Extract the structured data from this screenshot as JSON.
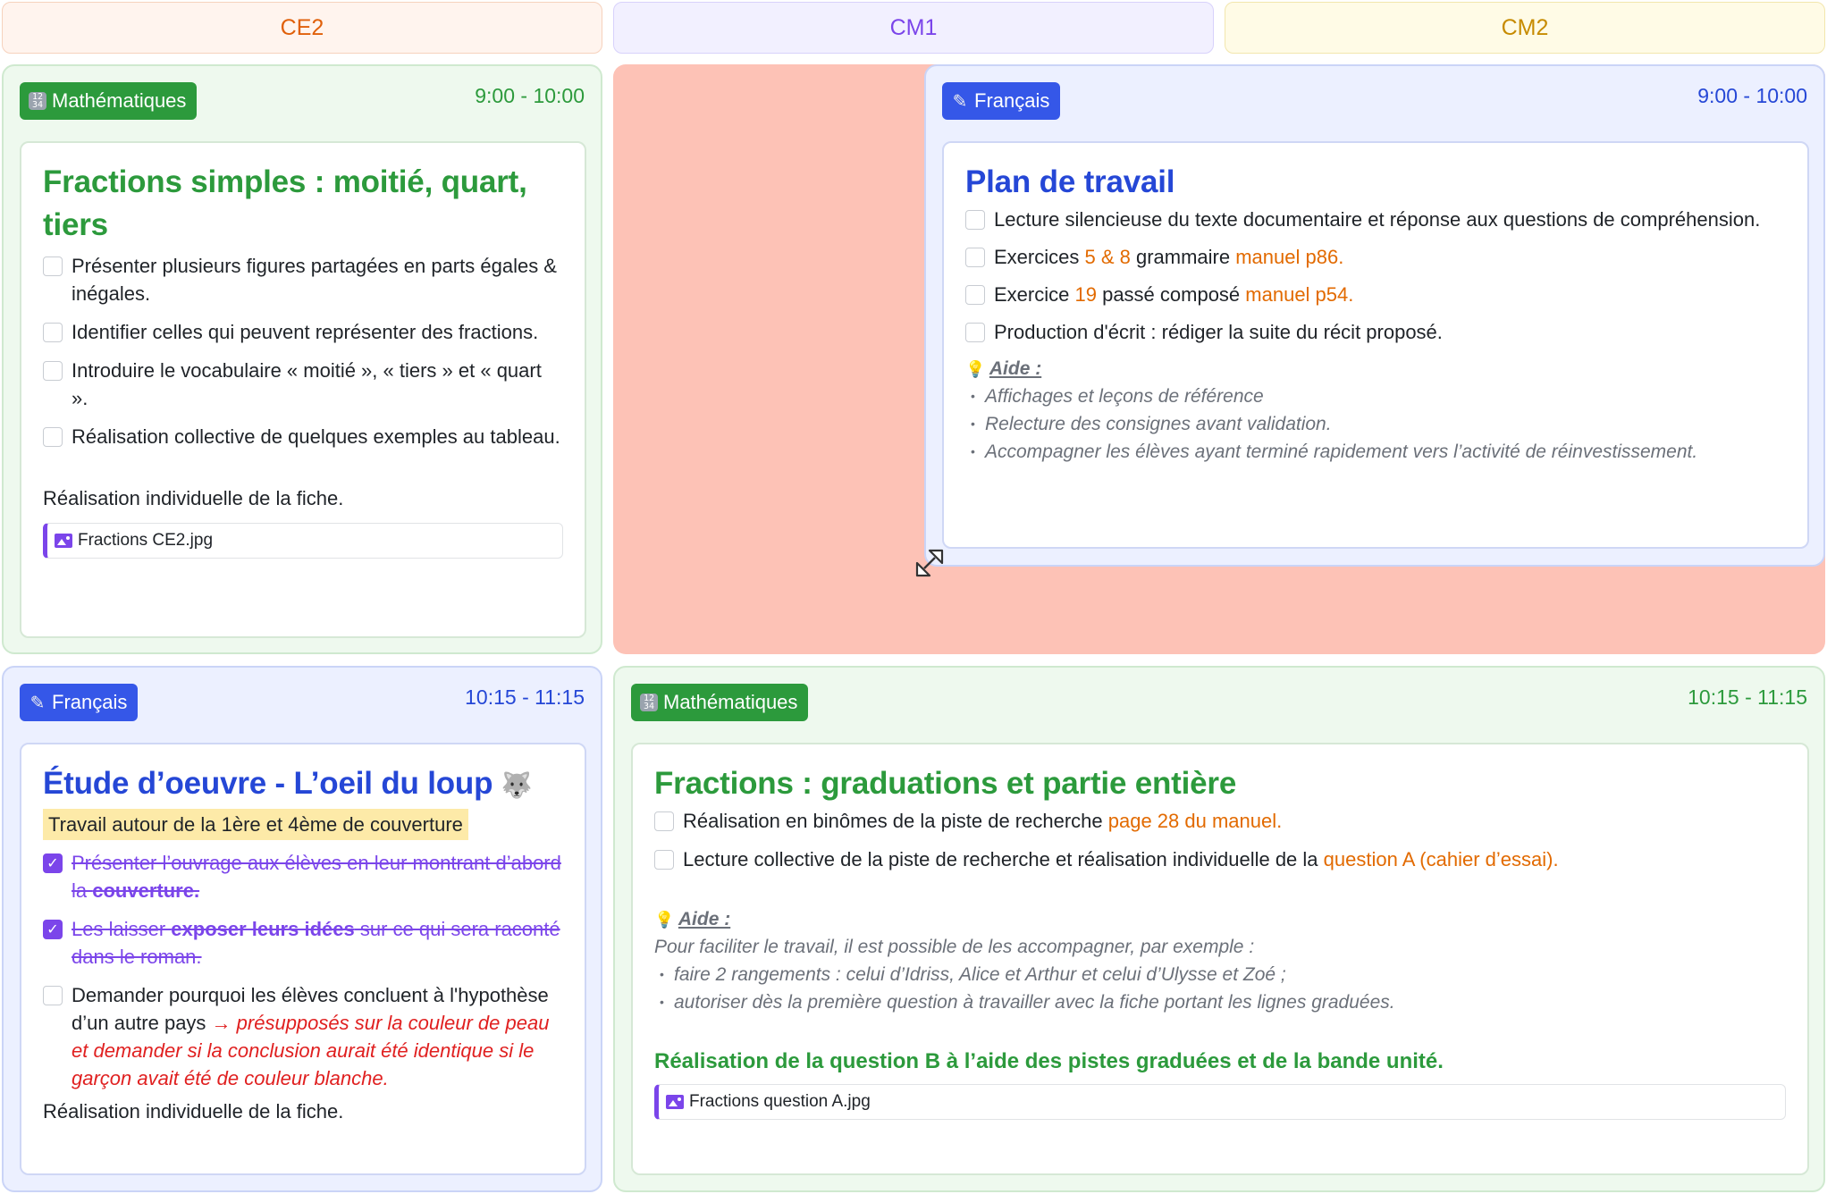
{
  "columns": [
    "CE2",
    "CM1",
    "CM2"
  ],
  "colors": {
    "ce2": "#e0600a",
    "cm1": "#7b45ea",
    "cm2": "#c78b00",
    "green": "#2c9a3c",
    "blue": "#2547d6",
    "drop_zone": "#fdc2b6"
  },
  "ce2_maths": {
    "tag": "Mathématiques",
    "tag_icon": "numbers-icon",
    "time": "9:00 - 10:00",
    "title": "Fractions simples : moitié, quart, tiers",
    "tasks": [
      "Présenter plusieurs figures partagées en parts égales & inégales.",
      "Identifier celles qui peuvent représenter des fractions.",
      "Introduire le vocabulaire « moitié », « tiers » et « quart ».",
      "Réalisation collective de quelques exemples au tableau."
    ],
    "note": "Réalisation individuelle de la fiche.",
    "file": "Fractions CE2.jpg"
  },
  "cm1_francais": {
    "tag": "Français",
    "tag_icon": "pen-icon",
    "time": "9:00 - 10:00",
    "title": "Plan de travail",
    "task1": "Lecture silencieuse du texte documentaire et réponse aux questions de compréhension.",
    "task2": {
      "a": "Exercices ",
      "b": "5 & 8",
      "c": " grammaire ",
      "d": "manuel p86."
    },
    "task3": {
      "a": "Exercice ",
      "b": "19",
      "c": " passé composé ",
      "d": "manuel p54."
    },
    "task4": "Production d'écrit : rédiger la suite du récit proposé.",
    "aide_title": "Aide :",
    "aide_items": [
      "Affichages et leçons de référence",
      "Relecture des consignes avant validation.",
      "Accompagner les élèves ayant terminé rapidement vers l’activité de réinvestissement."
    ]
  },
  "ce2_francais": {
    "tag": "Français",
    "tag_icon": "pen-icon",
    "time": "10:15 - 11:15",
    "title": "Étude d’oeuvre - L’oeil du loup",
    "title_icon": "wolf-icon",
    "highlight": "Travail autour de la 1ère et 4ème de couverture",
    "task1": {
      "a": "Présenter l’ouvrage aux élèves en leur montrant d’abord la ",
      "b": "couverture."
    },
    "task2": {
      "a": "Les laisser ",
      "b": "exposer leurs idées",
      "c": " sur ce qui sera raconté dans le roman."
    },
    "task3": {
      "a": "Demander pourquoi les élèves concluent à l'hypothèse d’un autre pays ",
      "b": "→ présupposés sur la couleur de peau et demander si la conclusion aurait été identique si le garçon avait été de couleur blanche."
    },
    "note": "Réalisation individuelle de la fiche."
  },
  "cm_maths": {
    "tag": "Mathématiques",
    "tag_icon": "numbers-icon",
    "time": "10:15 - 11:15",
    "title": "Fractions : graduations et partie entière",
    "task1": {
      "a": "Réalisation en binômes de la piste de recherche ",
      "b": "page 28 du manuel."
    },
    "task2": {
      "a": "Lecture collective de la piste de recherche et réalisation individuelle de la ",
      "b": "question A (cahier d’essai)."
    },
    "aide_title": "Aide :",
    "aide_intro": "Pour faciliter le travail, il est possible de les accompagner, par exemple :",
    "aide_items": [
      "faire 2 rangements : celui d’Idriss, Alice et Arthur et celui d’Ulysse et Zoé ;",
      "autoriser dès la première question à travailler avec la fiche portant les lignes graduées."
    ],
    "conclusion": "Réalisation de la question B à l’aide des pistes graduées et de la bande unité.",
    "file": "Fractions question A.jpg"
  }
}
